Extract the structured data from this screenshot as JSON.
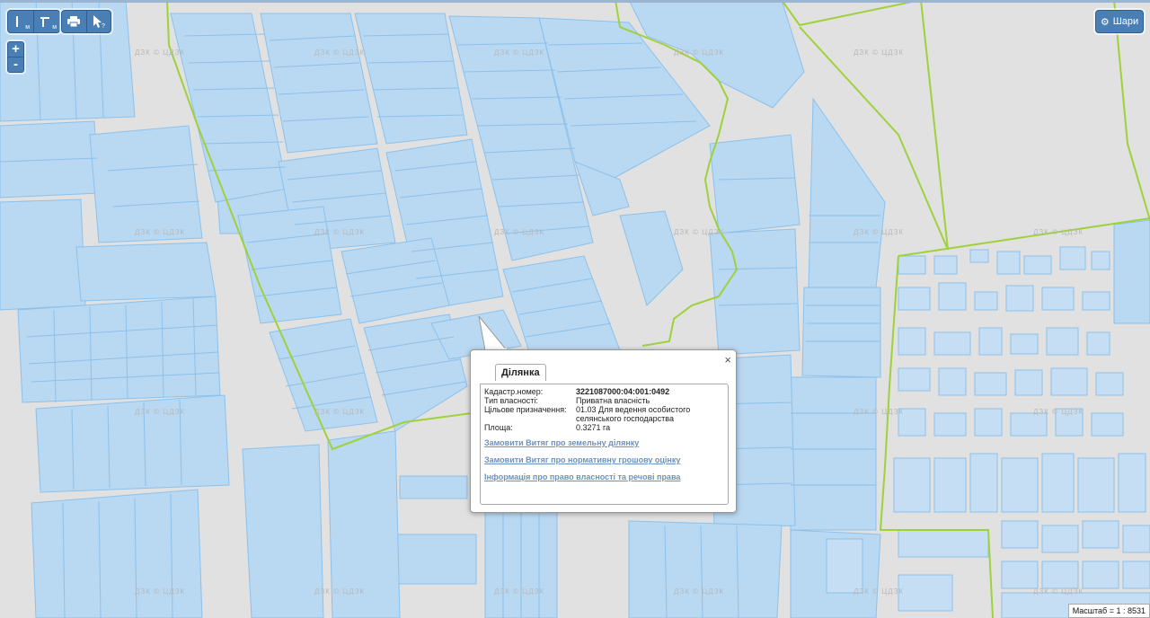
{
  "toolbar": {
    "ruler_label": "м",
    "angle_label": "м",
    "print_icon": "printer-icon",
    "info_icon": "cursor-question-icon"
  },
  "zoom": {
    "plus": "+",
    "minus": "-"
  },
  "layers": {
    "label": "Шари",
    "icon": "gear-icon"
  },
  "popup": {
    "tab": "Ділянка",
    "close": "×",
    "fields": [
      {
        "key": "Кадастр.номер:",
        "value": "3221087000:04:001:0492",
        "bold": true
      },
      {
        "key": "Тип власності:",
        "value": "Приватна власність",
        "bold": false
      },
      {
        "key": "Цільове призначення:",
        "value": "01.03 Для ведення особистого селянського господарства",
        "bold": false
      },
      {
        "key": "Площа:",
        "value": "0.3271 га",
        "bold": false
      }
    ],
    "links": [
      "Замовити Витяг про земельну ділянку",
      "Замовити Витяг про нормативну грошову оцінку",
      "Інформація про право власності та речові права"
    ]
  },
  "scale": "Масштаб = 1 : 8531",
  "watermark": "ДЗК © ЦДЗК",
  "colors": {
    "parcel_fill": "#b9d8f2",
    "parcel_stroke": "#8cc1eb",
    "boundary": "#9fd13a",
    "road": "#e1e1e1"
  }
}
